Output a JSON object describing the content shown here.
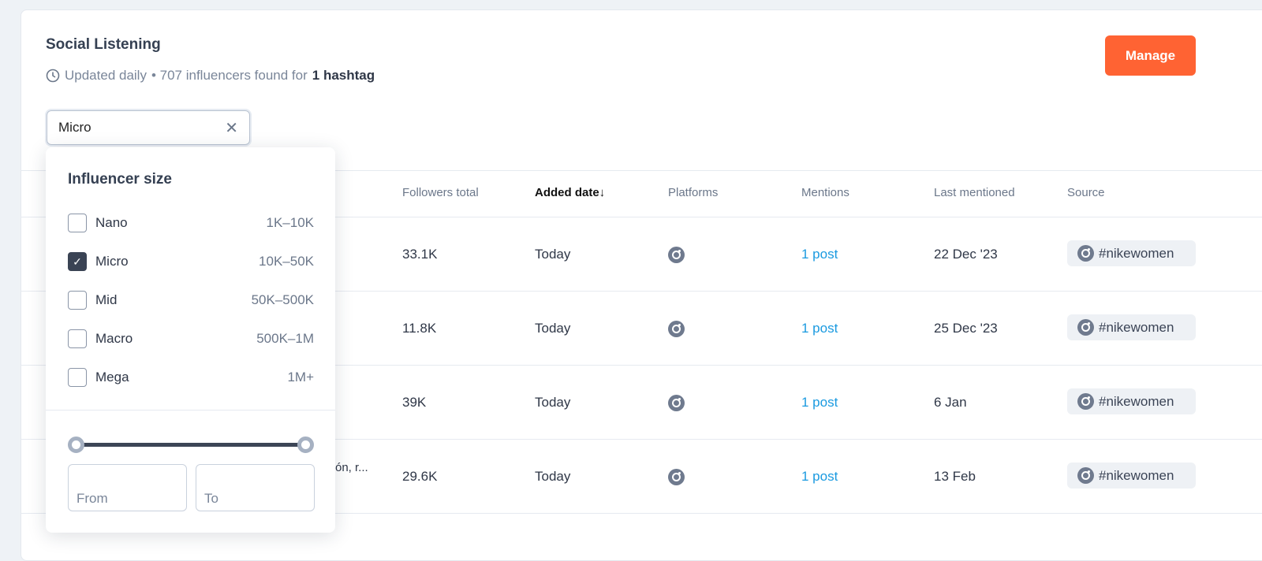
{
  "header": {
    "title": "Social Listening",
    "updated": "Updated daily",
    "count_text": "• 707 influencers found for",
    "hashtag_count": "1 hashtag",
    "manage_label": "Manage"
  },
  "filter": {
    "value": "Micro"
  },
  "table": {
    "columns": [
      "Followers total",
      "Added date↓",
      "Platforms",
      "Mentions",
      "Last mentioned",
      "Source"
    ],
    "rows": [
      {
        "name": "",
        "followers": "33.1K",
        "added": "Today",
        "platform": "instagram",
        "mentions": "1 post",
        "last": "22 Dec '23",
        "source": "#nikewomen"
      },
      {
        "name": "",
        "followers": "11.8K",
        "added": "Today",
        "platform": "instagram",
        "mentions": "1 post",
        "last": "25 Dec '23",
        "source": "#nikewomen"
      },
      {
        "name": "",
        "followers": "39K",
        "added": "Today",
        "platform": "instagram",
        "mentions": "1 post",
        "last": "6 Jan",
        "source": "#nikewomen"
      },
      {
        "name": "ón, r...",
        "followers": "29.6K",
        "added": "Today",
        "platform": "instagram",
        "mentions": "1 post",
        "last": "13 Feb",
        "source": "#nikewomen"
      }
    ]
  },
  "popover": {
    "title": "Influencer size",
    "options": [
      {
        "label": "Nano",
        "range": "1K–10K",
        "checked": false
      },
      {
        "label": "Micro",
        "range": "10K–50K",
        "checked": true
      },
      {
        "label": "Mid",
        "range": "50K–500K",
        "checked": false
      },
      {
        "label": "Macro",
        "range": "500K–1M",
        "checked": false
      },
      {
        "label": "Mega",
        "range": "1M+",
        "checked": false
      }
    ],
    "from_placeholder": "From",
    "to_placeholder": "To"
  },
  "colors": {
    "accent": "#ff6333",
    "link": "#1a9ae0"
  }
}
